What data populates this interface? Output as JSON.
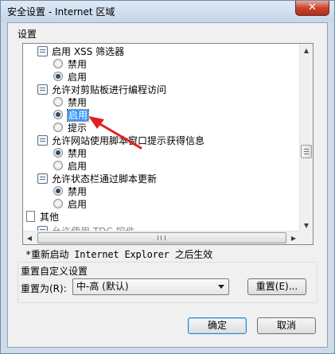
{
  "window": {
    "title": "安全设置 - Internet 区域",
    "close_glyph": "✕"
  },
  "settings": {
    "group_label": "设置",
    "items": [
      {
        "type": "head",
        "label": "启用 XSS 筛选器"
      },
      {
        "type": "option",
        "label": "禁用",
        "selected": false
      },
      {
        "type": "option",
        "label": "启用",
        "selected": true
      },
      {
        "type": "head",
        "label": "允许对剪贴板进行编程访问"
      },
      {
        "type": "option",
        "label": "禁用",
        "selected": false
      },
      {
        "type": "option",
        "label": "启用",
        "selected": true,
        "focused": true
      },
      {
        "type": "option",
        "label": "提示",
        "selected": false
      },
      {
        "type": "head",
        "label": "允许网站使用脚本窗口提示获得信息"
      },
      {
        "type": "option",
        "label": "禁用",
        "selected": true
      },
      {
        "type": "option",
        "label": "启用",
        "selected": false
      },
      {
        "type": "head",
        "label": "允许状态栏通过脚本更新"
      },
      {
        "type": "option",
        "label": "禁用",
        "selected": true
      },
      {
        "type": "option",
        "label": "启用",
        "selected": false
      },
      {
        "type": "section",
        "label": "其他"
      },
      {
        "type": "cutoff",
        "label": "允许使用 TDC 控件"
      }
    ],
    "scroll_up": "▲",
    "scroll_down": "▼",
    "scroll_left": "◀",
    "scroll_right": "▶"
  },
  "restart_note": "*重新启动 Internet Explorer 之后生效",
  "reset": {
    "title": "重置自定义设置",
    "reset_for_label": "重置为(R):",
    "dropdown_value": "中-高 (默认)",
    "reset_button": "重置(E)..."
  },
  "buttons": {
    "ok": "确定",
    "cancel": "取消"
  },
  "colors": {
    "annotation_arrow": "#e02020",
    "focus_highlight": "#3399ff"
  }
}
